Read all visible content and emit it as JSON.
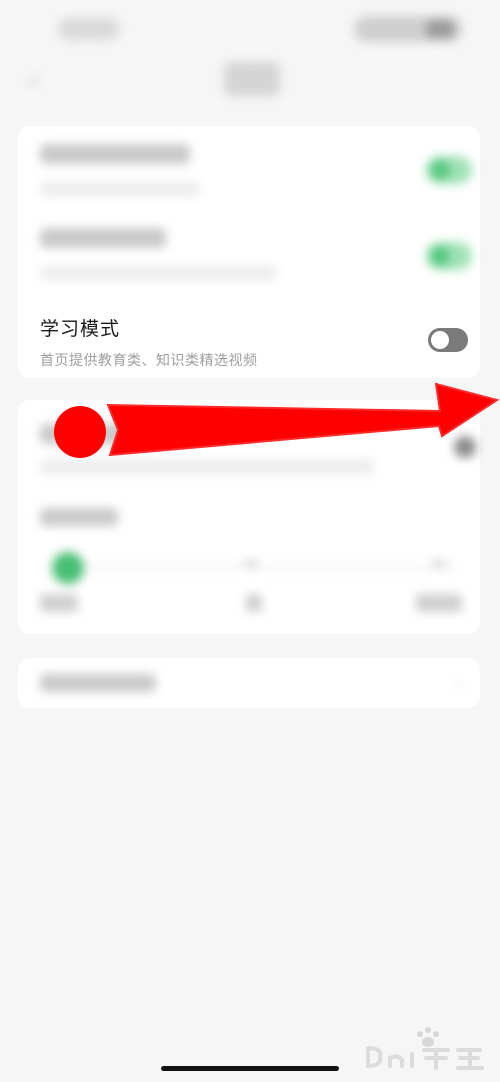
{
  "settings": {
    "learning_mode": {
      "title": "学习模式",
      "subtitle": "首页提供教育类、知识类精选视频",
      "enabled": false
    }
  },
  "icons": {
    "back": "chevron-left-icon",
    "annotation": "red-arrow-icon",
    "list_chevron": "chevron-right-icon"
  },
  "colors": {
    "background": "#f6f6f6",
    "card": "#ffffff",
    "accent_green": "#49bf73",
    "annotation_red": "#ff0000",
    "toggle_off": "#7a7a7a"
  }
}
